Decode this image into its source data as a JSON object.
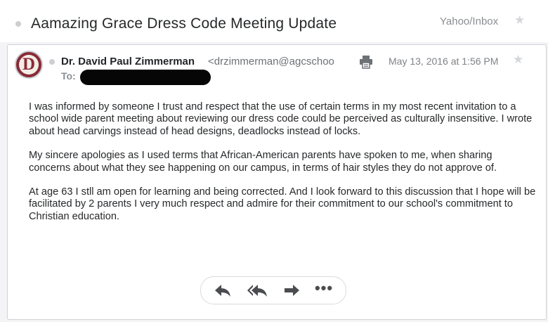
{
  "header": {
    "subject": "Aamazing Grace Dress Code Meeting Update",
    "folder": "Yahoo/Inbox"
  },
  "message": {
    "avatar_letter": "D",
    "from_name": "Dr. David Paul Zimmerman",
    "from_email": "<drzimmerman@agcschoo",
    "date": "May 13, 2016 at 1:56 PM",
    "to_label": "To:",
    "paragraphs": [
      "I was informed by someone I trust and respect that the use of certain terms in my most recent invitation to a school wide parent meeting about reviewing our dress code could be perceived as culturally insensitive. I wrote about head carvings instead of head designs, deadlocks instead of locks.",
      "My sincere apologies as I used terms that African-American parents have spoken to me, when sharing concerns about what they see happening on our campus, in terms of hair styles they do not approve of.",
      "At age 63 I stll am open for learning and being corrected. And I look forward to this discussion that I hope will be facilitated by 2 parents I very much respect and admire for their commitment to our school's commitment to Christian education."
    ]
  },
  "actions": {
    "more_label": "•••",
    "icons": [
      "reply-icon",
      "reply-all-icon",
      "forward-icon",
      "more-icon"
    ]
  },
  "colors": {
    "avatar": "#8a2a36",
    "icon": "#4a4c50",
    "star": "#d4d6d9"
  }
}
